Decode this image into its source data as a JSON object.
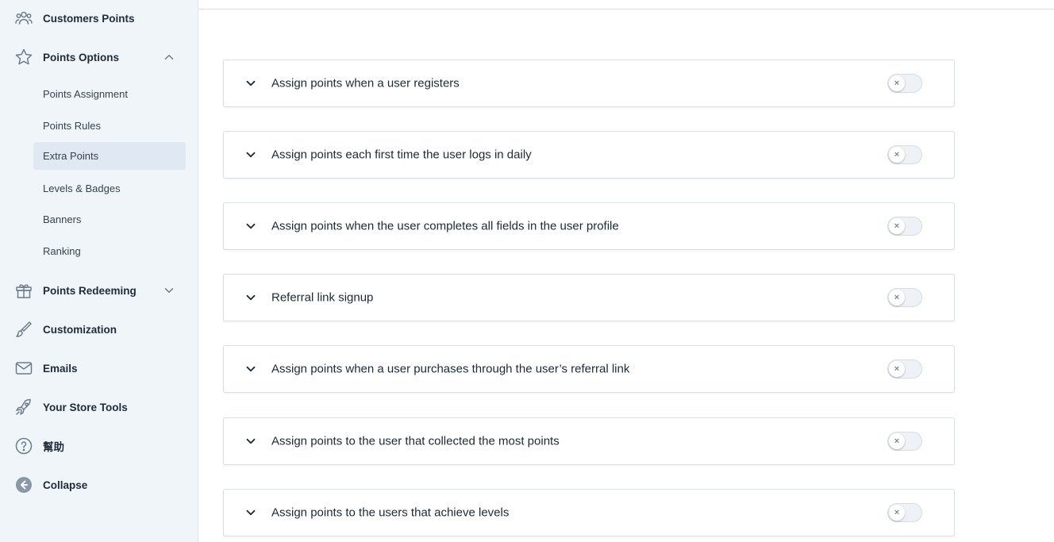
{
  "sidebar": {
    "items": [
      {
        "label": "Customers Points",
        "icon": "users-icon"
      },
      {
        "label": "Points Options",
        "icon": "star-icon",
        "expanded": true
      },
      {
        "label": "Points Redeeming",
        "icon": "gift-icon",
        "expanded": false
      },
      {
        "label": "Customization",
        "icon": "brush-icon"
      },
      {
        "label": "Emails",
        "icon": "envelope-icon"
      },
      {
        "label": "Your Store Tools",
        "icon": "rocket-icon"
      },
      {
        "label": "幫助",
        "icon": "help-icon"
      },
      {
        "label": "Collapse",
        "icon": "collapse-icon"
      }
    ],
    "submenu": [
      {
        "label": "Points Assignment"
      },
      {
        "label": "Points Rules"
      },
      {
        "label": "Extra Points",
        "active": true
      },
      {
        "label": "Levels & Badges"
      },
      {
        "label": "Banners"
      },
      {
        "label": "Ranking"
      }
    ]
  },
  "panels": [
    {
      "title": "Assign points when a user registers",
      "enabled": false,
      "toggle_glyph": "×"
    },
    {
      "title": "Assign points each first time the user logs in daily",
      "enabled": false,
      "toggle_glyph": "×"
    },
    {
      "title": "Assign points when the user completes all fields in the user profile",
      "enabled": false,
      "toggle_glyph": "×"
    },
    {
      "title": "Referral link signup",
      "enabled": false,
      "toggle_glyph": "×"
    },
    {
      "title": "Assign points when a user purchases through the user’s referral link",
      "enabled": false,
      "toggle_glyph": "×"
    },
    {
      "title": "Assign points to the user that collected the most points",
      "enabled": false,
      "toggle_glyph": "×"
    },
    {
      "title": "Assign points to the users that achieve levels",
      "enabled": false,
      "toggle_glyph": "×"
    }
  ],
  "colors": {
    "sidebar_bg": "#f0f5fa",
    "active_sub_bg": "#e0e9f2",
    "text": "#1d2935",
    "icon": "#6e7c8a"
  }
}
